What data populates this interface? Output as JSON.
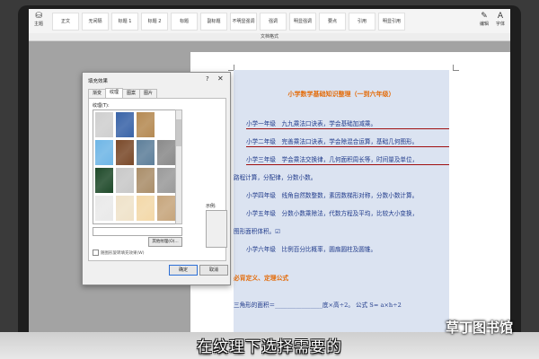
{
  "ribbon": {
    "style_labels": [
      "正文",
      "无间隔",
      "标题 1",
      "标题 2",
      "标题",
      "副标题",
      "不明显强调",
      "强调",
      "明显强调",
      "要点",
      "引用",
      "明显引用"
    ],
    "buttons": [
      {
        "glyph": "⛁",
        "label": "主题"
      },
      {
        "glyph": "✎",
        "label": "编辑"
      },
      {
        "glyph": "A",
        "label": "字体"
      }
    ],
    "group_label": "文档格式"
  },
  "dialog": {
    "title": "填充效果",
    "help": "?",
    "close": "✕",
    "tabs": [
      "渐变",
      "纹理",
      "图案",
      "图片"
    ],
    "active_tab": "纹理",
    "texture_label": "纹理(T):",
    "other_texture_button": "其他纹理(O)...",
    "rotate_label": "随图形旋转填充效果(W)",
    "sample_label": "示例:",
    "ok": "确定",
    "cancel": "取消",
    "texture_colors": [
      [
        "#cfcfcf",
        "#3a64a8",
        "#b58a53"
      ],
      [
        "#6fb6e6",
        "#7a4a2a",
        "#5e7f9a",
        "#8a8a8a"
      ],
      [
        "#1f4a2a",
        "#c8c8c8",
        "#aa8e6a",
        "#9a9a9a"
      ],
      [
        "#e9e9e9",
        "#efe2c9",
        "#f3d8a8",
        "#c6a57c"
      ]
    ]
  },
  "document": {
    "title": "小学数学基础知识整理（一到六年级）",
    "lines": [
      "小学一年级　九九乘法口诀表，学会基础加减乘。",
      "小学二年级　完善乘法口诀表，学会除混合运算，基础几何图形。",
      "小学三年级　学会乘法交换律，几何面积周长等，时间量及单位，",
      "路程计算，分配律，分数小数。",
      "小学四年级　线角自然数整数，素因数梯形对称，分数小数计算。",
      "小学五年级　分数小数乘除法，代数方程及平均，比较大小变换，",
      "图形面积体积。☑",
      "小学六年级　比例百分比概率，圆扇圆柱及圆锥。"
    ],
    "heading2": "必背定义、定理公式",
    "formula": "三角形的面积＝________________底×高÷2。 公式 S= a×h÷2"
  },
  "caption": "在纹理下选择需要的",
  "watermark": "草丁图书馆"
}
